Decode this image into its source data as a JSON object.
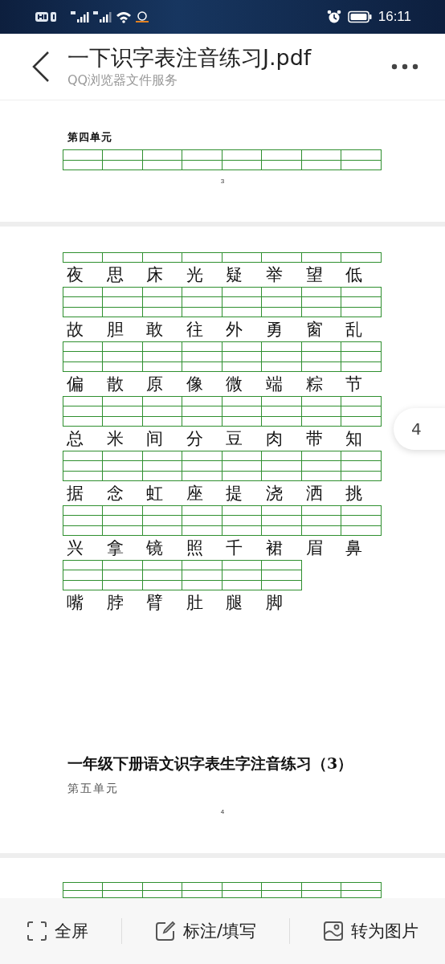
{
  "status_bar": {
    "time": "16:11"
  },
  "header": {
    "title": "一下识字表注音练习J.pdf",
    "subtitle": "QQ浏览器文件服务"
  },
  "pages": [
    {
      "kind": "tail",
      "unit_label": "第四单元",
      "page_number": "3"
    },
    {
      "kind": "full",
      "character_rows": [
        [
          "夜",
          "思",
          "床",
          "光",
          "疑",
          "举",
          "望",
          "低"
        ],
        [
          "故",
          "胆",
          "敢",
          "往",
          "外",
          "勇",
          "窗",
          "乱"
        ],
        [
          "偏",
          "散",
          "原",
          "像",
          "微",
          "端",
          "粽",
          "节"
        ],
        [
          "总",
          "米",
          "间",
          "分",
          "豆",
          "肉",
          "带",
          "知"
        ],
        [
          "据",
          "念",
          "虹",
          "座",
          "提",
          "浇",
          "洒",
          "挑"
        ],
        [
          "兴",
          "拿",
          "镜",
          "照",
          "千",
          "裙",
          "眉",
          "鼻"
        ],
        [
          "嘴",
          "脖",
          "臂",
          "肚",
          "腿",
          "脚"
        ]
      ],
      "title": "一年级下册语文识字表生字注音练习（3）",
      "unit_label": "第五单元",
      "page_number": "4"
    },
    {
      "kind": "head"
    }
  ],
  "page_indicator": "4",
  "toolbar": [
    {
      "kind": "fullscreen",
      "label": "全屏"
    },
    {
      "kind": "annotate",
      "label": "标注/填写"
    },
    {
      "kind": "image",
      "label": "转为图片"
    }
  ]
}
